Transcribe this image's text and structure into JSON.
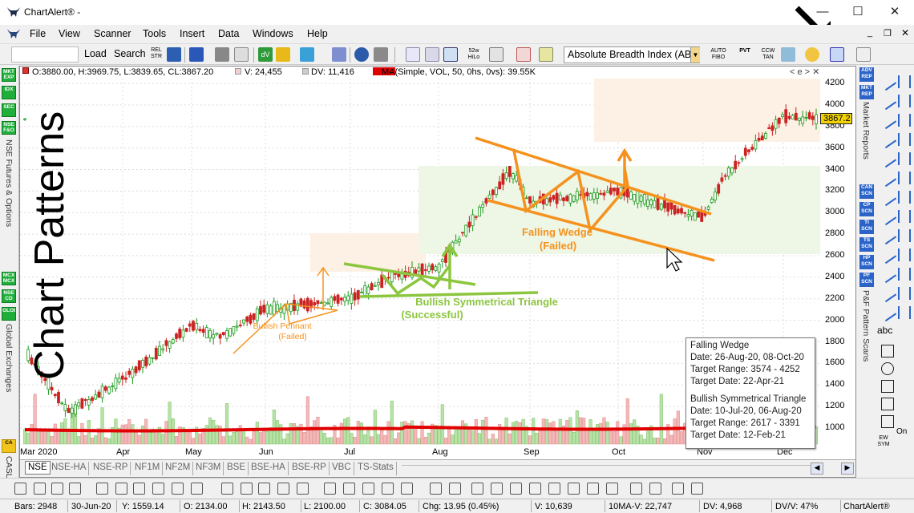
{
  "app": {
    "title": "ChartAlert® -",
    "window_controls": [
      "—",
      "☐",
      "✕"
    ]
  },
  "menu": [
    "File",
    "View",
    "Scanner",
    "Tools",
    "Insert",
    "Data",
    "Windows",
    "Help"
  ],
  "toolbar": {
    "load_label": "Load",
    "search_label": "Search",
    "indicator_value": "Absolute Breadth Index (AB",
    "icon_labels": [
      "REL STR",
      "52w HiLo",
      "AUTO FIBO",
      "PVT",
      "CCW TAN"
    ]
  },
  "chart_title": "Chart Patterns",
  "infobar": {
    "ohlc": "O:3880.00, H:3969.75, L:3839.65, CL:3867.20",
    "volume": "V: 24,455",
    "dv": "DV: 11,416",
    "ma": "MA(Simple, VOL, 50, 0hs, 0vs): 39.55K",
    "controls": "< e > ✕"
  },
  "last_price": "3867.2",
  "y_axis_labels": [
    "4200",
    "4000",
    "3800",
    "3600",
    "3400",
    "3200",
    "3000",
    "2800",
    "2600",
    "2400",
    "2200",
    "2000",
    "1800",
    "1600",
    "1400",
    "1200",
    "1000"
  ],
  "x_axis_labels": [
    "Mar 2020",
    "Apr",
    "May",
    "Jun",
    "Jul",
    "Aug",
    "Sep",
    "Oct",
    "Nov",
    "Dec"
  ],
  "annotations": {
    "pennant": "Bullish Pennant",
    "pennant_status": "(Failed)",
    "triangle": "Bullish Symmetrical Triangle",
    "triangle_status": "(Successful)",
    "wedge": "Falling Wedge",
    "wedge_status": "(Failed)"
  },
  "tooltip": {
    "wedge_title": "Falling Wedge",
    "wedge_date": "Date: 26-Aug-20, 08-Oct-20",
    "wedge_range": "Target Range: 3574 - 4252",
    "wedge_target": "Target Date: 22-Apr-21",
    "tri_title": "Bullish Symmetrical Triangle",
    "tri_date": "Date: 10-Jul-20, 06-Aug-20",
    "tri_range": "Target Range: 2617 - 3391",
    "tri_target": "Target Date: 12-Feb-21"
  },
  "tabs": [
    "NSE",
    "NSE-HA",
    "NSE-RP",
    "NF1M",
    "NF2M",
    "NF3M",
    "BSE",
    "BSE-HA",
    "BSE-RP",
    "VBC",
    "TS-Stats"
  ],
  "left_panel": {
    "buttons": [
      "MKT EXP",
      "IDX",
      "SEC",
      "NSE F&O",
      "MCX MCX",
      "NSE CD",
      "GLOBAL"
    ],
    "label1": "NSE Futures & Options",
    "label2": "Global Exchanges",
    "label3": "CASL"
  },
  "right_panel": {
    "buttons": [
      "ADV REP",
      "MKT REP",
      "CAN SCN",
      "CP SCN",
      "TI SCN",
      "TS SCN",
      "HP SCN",
      "PF SCN"
    ],
    "label1": "Market Reports",
    "label2": "P&F Pattern Scans",
    "on_label": "On",
    "abc_label": "abc",
    "ew_label": "EW SYM"
  },
  "status": {
    "bars": "Bars: 2948",
    "date": "30-Jun-20",
    "y": "Y: 1559.14",
    "o": "O: 2134.00",
    "h": "H: 2143.50",
    "l": "L: 2100.00",
    "c": "C: 3084.05",
    "chg": "Chg: 13.95 (0.45%)",
    "v": "V: 10,639",
    "ma": "10MA-V: 22,747",
    "dv": "DV: 4,968",
    "dvv": "DV/V: 47%",
    "app": "ChartAlert®"
  },
  "chart_data": {
    "type": "candlestick",
    "ylim": [
      900,
      4250
    ],
    "x_months": [
      "Mar 2020",
      "Apr",
      "May",
      "Jun",
      "Jul",
      "Aug",
      "Sep",
      "Oct",
      "Nov",
      "Dec"
    ],
    "price_anchors": [
      {
        "t": "Mar",
        "v": 1700
      },
      {
        "t": "Mar-end",
        "v": 1150
      },
      {
        "t": "Apr",
        "v": 1450
      },
      {
        "t": "May",
        "v": 1950
      },
      {
        "t": "May-mid",
        "v": 1850
      },
      {
        "t": "Jun",
        "v": 2100
      },
      {
        "t": "Jul",
        "v": 2200
      },
      {
        "t": "Jul-mid",
        "v": 2400
      },
      {
        "t": "Aug",
        "v": 2500
      },
      {
        "t": "Aug-end",
        "v": 3400
      },
      {
        "t": "Sep",
        "v": 3100
      },
      {
        "t": "Oct",
        "v": 3200
      },
      {
        "t": "Nov",
        "v": 2950
      },
      {
        "t": "Nov-end",
        "v": 3350
      },
      {
        "t": "Dec",
        "v": 3900
      },
      {
        "t": "Dec-end",
        "v": 3867
      }
    ],
    "patterns": [
      {
        "name": "Bullish Pennant",
        "status": "Failed"
      },
      {
        "name": "Bullish Symmetrical Triangle",
        "status": "Successful",
        "target_range": [
          2617,
          3391
        ]
      },
      {
        "name": "Falling Wedge",
        "status": "Failed",
        "target_range": [
          3574,
          4252
        ]
      }
    ],
    "moving_average": {
      "name": "MA(Simple, VOL, 50, 0hs, 0vs)",
      "value": "39.55K"
    }
  },
  "colors": {
    "up_candle": "#1a9a1a",
    "down_candle": "#cc2222",
    "orange": "#f5921e",
    "green_annot": "#8cc63f",
    "ma_line": "#e00000",
    "zone_green": "#eef6e6",
    "zone_orange": "#fdf0e4"
  }
}
